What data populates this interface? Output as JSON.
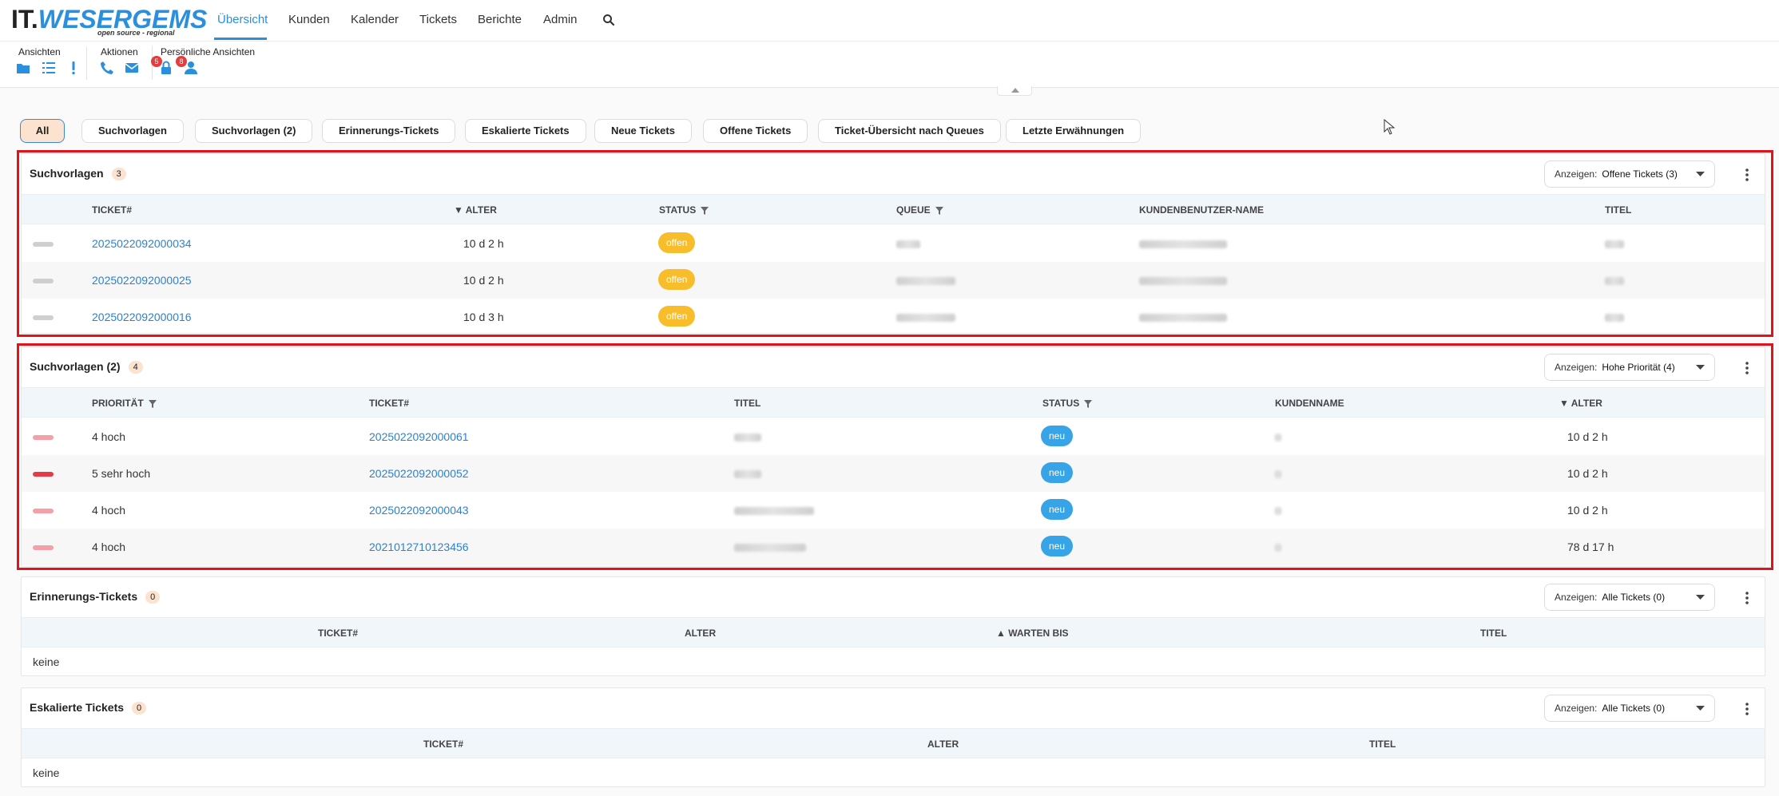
{
  "logo": {
    "it": "IT.",
    "brand": "WESERGEMS",
    "tagline": "open source - regional"
  },
  "nav": [
    "Übersicht",
    "Kunden",
    "Kalender",
    "Tickets",
    "Berichte",
    "Admin"
  ],
  "toolbar": {
    "groups": [
      "Ansichten",
      "Aktionen",
      "Persönliche Ansichten"
    ],
    "badges": [
      "5",
      "8"
    ]
  },
  "filters": [
    "All",
    "Suchvorlagen",
    "Suchvorlagen (2)",
    "Erinnerungs-Tickets",
    "Eskalierte Tickets",
    "Neue Tickets",
    "Offene Tickets",
    "Ticket-Übersicht nach Queues",
    "Letzte Erwähnungen"
  ],
  "widgets": [
    {
      "title": "Suchvorlagen",
      "count": "3",
      "show_label": "Anzeigen:",
      "show_value": "Offene Tickets (3)",
      "columns": [
        "TICKET#",
        "▼ ALTER",
        "STATUS",
        "QUEUE",
        "KUNDENBENUTZER-NAME",
        "TITEL"
      ],
      "rows": [
        {
          "ticket": "2025022092000034",
          "age": "10 d 2 h",
          "status": "offen"
        },
        {
          "ticket": "2025022092000025",
          "age": "10 d 2 h",
          "status": "offen"
        },
        {
          "ticket": "2025022092000016",
          "age": "10 d 3 h",
          "status": "offen"
        }
      ]
    },
    {
      "title": "Suchvorlagen (2)",
      "count": "4",
      "show_label": "Anzeigen:",
      "show_value": "Hohe Priorität (4)",
      "columns": [
        "PRIORITÄT",
        "TICKET#",
        "TITEL",
        "STATUS",
        "KUNDENNAME",
        "▼ ALTER"
      ],
      "rows": [
        {
          "priority": "4 hoch",
          "ticket": "2025022092000061",
          "status": "neu",
          "age": "10 d 2 h"
        },
        {
          "priority": "5 sehr hoch",
          "ticket": "2025022092000052",
          "status": "neu",
          "age": "10 d 2 h"
        },
        {
          "priority": "4 hoch",
          "ticket": "2025022092000043",
          "status": "neu",
          "age": "10 d 2 h"
        },
        {
          "priority": "4 hoch",
          "ticket": "2021012710123456",
          "status": "neu",
          "age": "78 d 17 h"
        }
      ]
    },
    {
      "title": "Erinnerungs-Tickets",
      "count": "0",
      "show_label": "Anzeigen:",
      "show_value": "Alle Tickets (0)",
      "columns": [
        "TICKET#",
        "ALTER",
        "▲ WARTEN BIS",
        "TITEL"
      ],
      "empty": "keine"
    },
    {
      "title": "Eskalierte Tickets",
      "count": "0",
      "show_label": "Anzeigen:",
      "show_value": "Alle Tickets (0)",
      "columns": [
        "TICKET#",
        "ALTER",
        "TITEL"
      ],
      "empty": "keine"
    }
  ],
  "colors": {
    "accent": "#2a8fdc",
    "offen": "#f8bd2a",
    "neu": "#36a4e6",
    "prio_high": "#f4a0a6",
    "prio_very_high": "#e53b46",
    "prio_normal": "#cfcfcf",
    "highlight": "#e0121a"
  }
}
